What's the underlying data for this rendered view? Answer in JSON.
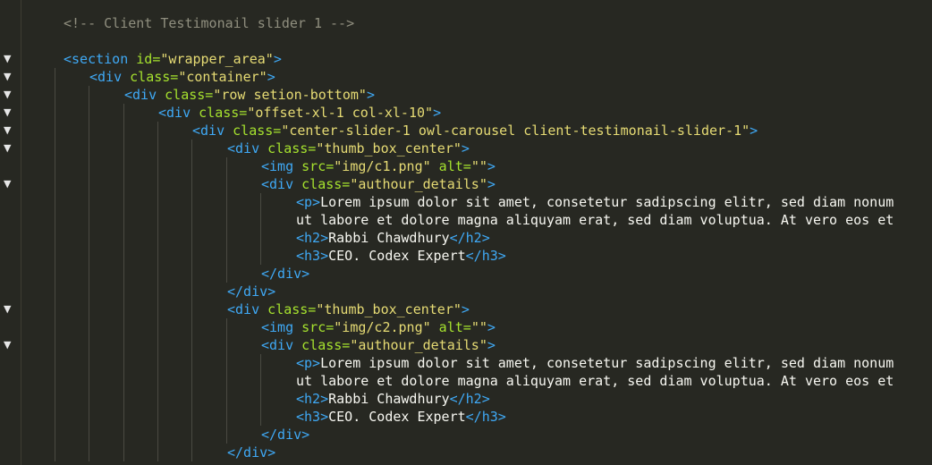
{
  "colors": {
    "background": "#272822",
    "tag": "#3fa9f5",
    "attribute": "#a6e22e",
    "string": "#e6db74",
    "text": "#f8f8f2",
    "comment": "#908f7f"
  },
  "fold_marker": "▼",
  "lines": [
    {
      "indent": 1,
      "fold": false,
      "tokens": [
        {
          "t": "cmt",
          "v": "<!-- Client Testimonail slider 1 -->"
        }
      ]
    },
    {
      "indent": 0,
      "fold": false,
      "tokens": []
    },
    {
      "indent": 1,
      "fold": true,
      "tokens": [
        {
          "t": "tag",
          "v": "<section "
        },
        {
          "t": "attr",
          "v": "id="
        },
        {
          "t": "str",
          "v": "\"wrapper_area\""
        },
        {
          "t": "tag",
          "v": ">"
        }
      ]
    },
    {
      "indent": 2,
      "fold": true,
      "tokens": [
        {
          "t": "tag",
          "v": "<div "
        },
        {
          "t": "attr",
          "v": "class="
        },
        {
          "t": "str",
          "v": "\"container\""
        },
        {
          "t": "tag",
          "v": ">"
        }
      ]
    },
    {
      "indent": 3,
      "fold": true,
      "tokens": [
        {
          "t": "tag",
          "v": "<div "
        },
        {
          "t": "attr",
          "v": "class="
        },
        {
          "t": "str",
          "v": "\"row setion-bottom\""
        },
        {
          "t": "tag",
          "v": ">"
        }
      ]
    },
    {
      "indent": 4,
      "fold": true,
      "tokens": [
        {
          "t": "tag",
          "v": "<div "
        },
        {
          "t": "attr",
          "v": "class="
        },
        {
          "t": "str",
          "v": "\"offset-xl-1 col-xl-10\""
        },
        {
          "t": "tag",
          "v": ">"
        }
      ]
    },
    {
      "indent": 5,
      "fold": true,
      "tokens": [
        {
          "t": "tag",
          "v": "<div "
        },
        {
          "t": "attr",
          "v": "class="
        },
        {
          "t": "str",
          "v": "\"center-slider-1 owl-carousel client-testimonail-slider-1\""
        },
        {
          "t": "tag",
          "v": ">"
        }
      ]
    },
    {
      "indent": 6,
      "fold": true,
      "tokens": [
        {
          "t": "tag",
          "v": "<div "
        },
        {
          "t": "attr",
          "v": "class="
        },
        {
          "t": "str",
          "v": "\"thumb_box_center\""
        },
        {
          "t": "tag",
          "v": ">"
        }
      ]
    },
    {
      "indent": 7,
      "fold": false,
      "tokens": [
        {
          "t": "tag",
          "v": "<img "
        },
        {
          "t": "attr",
          "v": "src="
        },
        {
          "t": "str",
          "v": "\"img/c1.png\""
        },
        {
          "t": "attr",
          "v": " alt="
        },
        {
          "t": "str",
          "v": "\"\""
        },
        {
          "t": "tag",
          "v": ">"
        }
      ]
    },
    {
      "indent": 7,
      "fold": true,
      "tokens": [
        {
          "t": "tag",
          "v": "<div "
        },
        {
          "t": "attr",
          "v": "class="
        },
        {
          "t": "str",
          "v": "\"authour_details\""
        },
        {
          "t": "tag",
          "v": ">"
        }
      ]
    },
    {
      "indent": 8,
      "fold": false,
      "tokens": [
        {
          "t": "tag",
          "v": "<p>"
        },
        {
          "t": "txt",
          "v": "Lorem ipsum dolor sit amet, consetetur sadipscing elitr, sed diam nonum"
        }
      ]
    },
    {
      "indent": 8,
      "fold": false,
      "tokens": [
        {
          "t": "txt",
          "v": "ut labore et dolore magna aliquyam erat, sed diam voluptua. At vero eos et"
        }
      ]
    },
    {
      "indent": 8,
      "fold": false,
      "tokens": [
        {
          "t": "tag",
          "v": "<h2>"
        },
        {
          "t": "txt",
          "v": "Rabbi Chawdhury"
        },
        {
          "t": "tag",
          "v": "</h2>"
        }
      ]
    },
    {
      "indent": 8,
      "fold": false,
      "tokens": [
        {
          "t": "tag",
          "v": "<h3>"
        },
        {
          "t": "txt",
          "v": "CEO. Codex Expert"
        },
        {
          "t": "tag",
          "v": "</h3>"
        }
      ]
    },
    {
      "indent": 7,
      "fold": false,
      "tokens": [
        {
          "t": "tag",
          "v": "</div>"
        }
      ]
    },
    {
      "indent": 6,
      "fold": false,
      "tokens": [
        {
          "t": "tag",
          "v": "</div>"
        }
      ]
    },
    {
      "indent": 6,
      "fold": true,
      "tokens": [
        {
          "t": "tag",
          "v": "<div "
        },
        {
          "t": "attr",
          "v": "class="
        },
        {
          "t": "str",
          "v": "\"thumb_box_center\""
        },
        {
          "t": "tag",
          "v": ">"
        }
      ]
    },
    {
      "indent": 7,
      "fold": false,
      "tokens": [
        {
          "t": "tag",
          "v": "<img "
        },
        {
          "t": "attr",
          "v": "src="
        },
        {
          "t": "str",
          "v": "\"img/c2.png\""
        },
        {
          "t": "attr",
          "v": " alt="
        },
        {
          "t": "str",
          "v": "\"\""
        },
        {
          "t": "tag",
          "v": ">"
        }
      ]
    },
    {
      "indent": 7,
      "fold": true,
      "tokens": [
        {
          "t": "tag",
          "v": "<div "
        },
        {
          "t": "attr",
          "v": "class="
        },
        {
          "t": "str",
          "v": "\"authour_details\""
        },
        {
          "t": "tag",
          "v": ">"
        }
      ]
    },
    {
      "indent": 8,
      "fold": false,
      "tokens": [
        {
          "t": "tag",
          "v": "<p>"
        },
        {
          "t": "txt",
          "v": "Lorem ipsum dolor sit amet, consetetur sadipscing elitr, sed diam nonum"
        }
      ]
    },
    {
      "indent": 8,
      "fold": false,
      "tokens": [
        {
          "t": "txt",
          "v": "ut labore et dolore magna aliquyam erat, sed diam voluptua. At vero eos et"
        }
      ]
    },
    {
      "indent": 8,
      "fold": false,
      "tokens": [
        {
          "t": "tag",
          "v": "<h2>"
        },
        {
          "t": "txt",
          "v": "Rabbi Chawdhury"
        },
        {
          "t": "tag",
          "v": "</h2>"
        }
      ]
    },
    {
      "indent": 8,
      "fold": false,
      "tokens": [
        {
          "t": "tag",
          "v": "<h3>"
        },
        {
          "t": "txt",
          "v": "CEO. Codex Expert"
        },
        {
          "t": "tag",
          "v": "</h3>"
        }
      ]
    },
    {
      "indent": 7,
      "fold": false,
      "tokens": [
        {
          "t": "tag",
          "v": "</div>"
        }
      ]
    },
    {
      "indent": 6,
      "fold": false,
      "tokens": [
        {
          "t": "tag",
          "v": "</div>"
        }
      ]
    }
  ]
}
